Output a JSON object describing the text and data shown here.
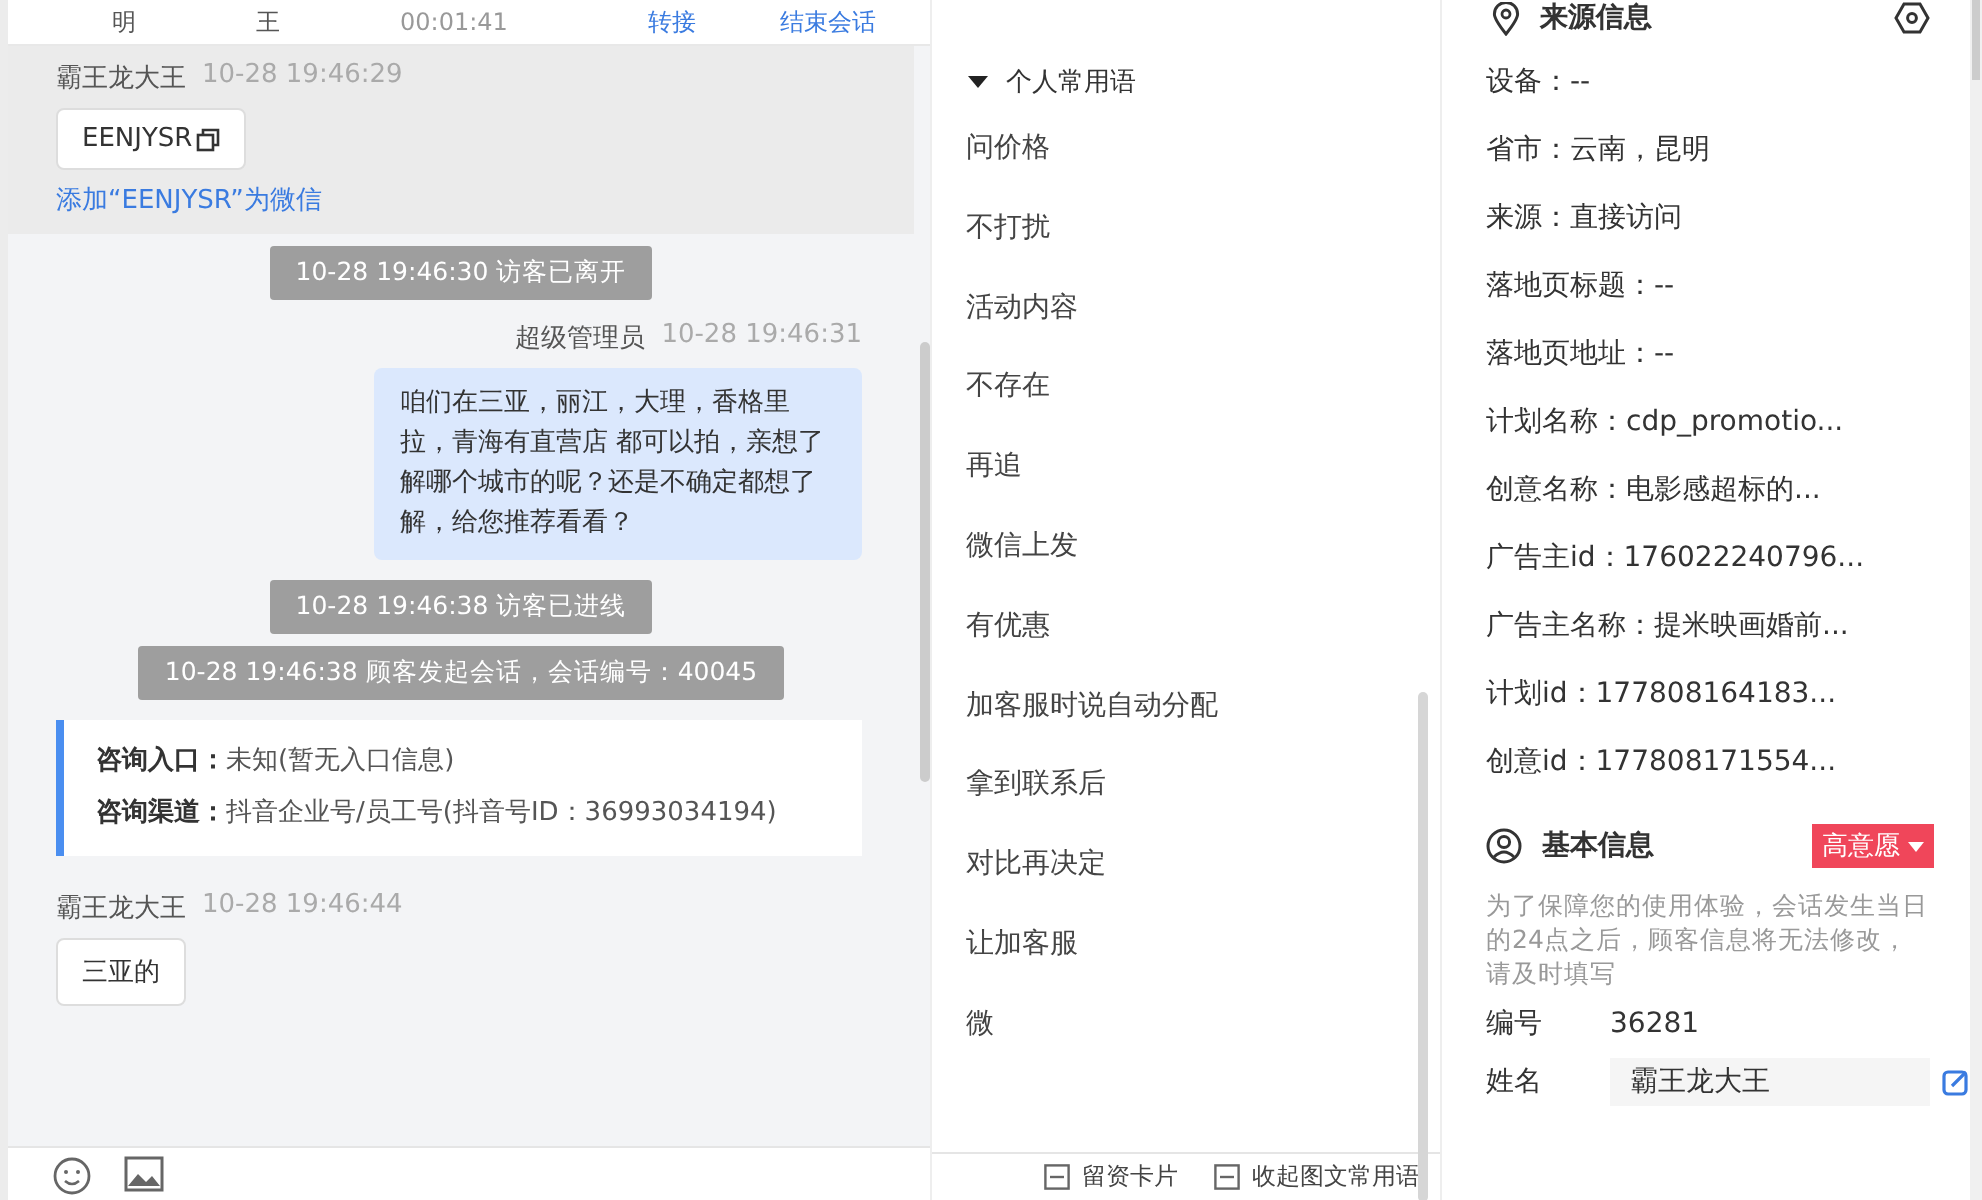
{
  "top_row": {
    "cells": [
      "明",
      "王",
      "00:01:41"
    ],
    "actions": [
      "转接",
      "结束会话"
    ]
  },
  "messages": [
    {
      "kind": "customer",
      "highlighted": true,
      "sender": "霸王龙大王",
      "time": "10-28 19:46:29",
      "text": "EENJYSR",
      "copyable": true,
      "link": "添加“EENJYSR”为微信"
    },
    {
      "kind": "system",
      "text": "10-28 19:46:30 访客已离开"
    },
    {
      "kind": "agent",
      "sender": "超级管理员",
      "time": "10-28 19:46:31",
      "text": "咱们在三亚，丽江，大理，香格里拉，青海有直营店 都可以拍，亲想了解哪个城市的呢？还是不确定都想了解，给您推荐看看？"
    },
    {
      "kind": "system",
      "text": "10-28 19:46:38 访客已进线"
    },
    {
      "kind": "system",
      "text": "10-28 19:46:38 顾客发起会话，会话编号：40045"
    },
    {
      "kind": "info",
      "lines": [
        {
          "label": "咨询入口：",
          "value": "未知(暂无入口信息)"
        },
        {
          "label": "咨询渠道：",
          "value": "抖音企业号/员工号(抖音号ID：36993034194)"
        }
      ]
    },
    {
      "kind": "customer",
      "highlighted": false,
      "sender": "霸王龙大王",
      "time": "10-28 19:46:44",
      "text": "三亚的",
      "copyable": false
    }
  ],
  "phrases": {
    "group": "个人常用语",
    "expanded": true,
    "items": [
      "问价格",
      "不打扰",
      "活动内容",
      "不存在",
      "再追",
      "微信上发",
      "有优惠",
      "加客服时说自动分配",
      "拿到联系后",
      "对比再决定",
      "让加客服",
      "微"
    ],
    "footer": [
      "留资卡片",
      "收起图文常用语"
    ]
  },
  "source": {
    "title": "来源信息",
    "rows": [
      "设备：--",
      "省市：云南，昆明",
      "来源：直接访问",
      "落地页标题：--",
      "落地页地址：--",
      "计划名称：cdp_promotio...",
      "创意名称：电影感超标的...",
      "广告主id：176022240796...",
      "广告主名称：提米映画婚前...",
      "计划id：177808164183...",
      "创意id：177808171554..."
    ]
  },
  "basic": {
    "title": "基本信息",
    "tag": "高意愿",
    "notice": "为了保障您的使用体验，会话发生当日的24点之后，顾客信息将无法修改，请及时填写",
    "fields": [
      {
        "kind": "text",
        "label": "编号",
        "value": "36281"
      },
      {
        "kind": "input",
        "label": "姓名",
        "value": "霸王龙大王"
      }
    ]
  }
}
